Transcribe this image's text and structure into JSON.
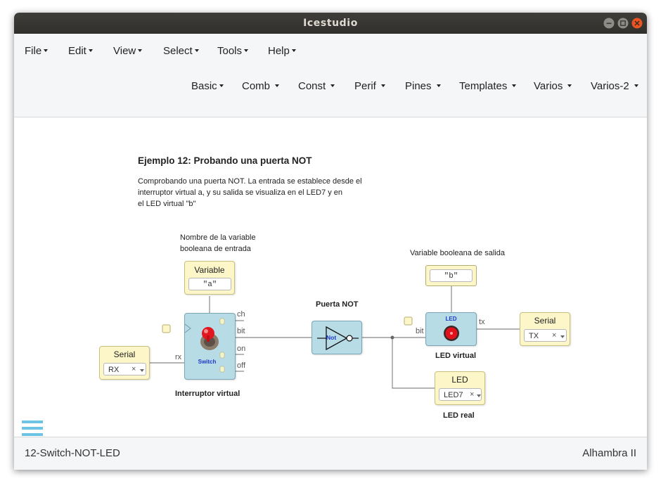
{
  "window": {
    "title": "Icestudio"
  },
  "menubar": {
    "main": [
      "File",
      "Edit",
      "View",
      "Select",
      "Tools",
      "Help"
    ],
    "collections": [
      "Basic",
      "Comb",
      "Const",
      "Perif",
      "Pines",
      "Templates",
      "Varios",
      "Varios-2"
    ]
  },
  "canvas": {
    "heading": "Ejemplo 12: Probando una puerta NOT",
    "description": [
      "Comprobando una puerta NOT. La entrada se establece desde el",
      "interruptor virtual a, y su salida se visualiza en el LED7 y en",
      "el LED virtual \"b\""
    ],
    "input_comment": [
      "Nombre de la variable",
      "booleana de entrada"
    ],
    "output_comment": "Variable booleana de salida",
    "variable_block": {
      "label": "Variable",
      "value": "\"a\""
    },
    "output_variable": {
      "value": "\"b\""
    },
    "switch_block": {
      "name": "Interruptor virtual",
      "text": "Switch",
      "ports": {
        "ch": "ch",
        "bit": "bit",
        "on": "on",
        "off": "off",
        "rx": "rx"
      }
    },
    "serial_in": {
      "label": "Serial",
      "value": "RX",
      "clear": "×"
    },
    "not_block": {
      "title": "Puerta NOT",
      "text": "Not"
    },
    "led_virtual": {
      "name": "LED virtual",
      "text": "LED",
      "ports": {
        "bit": "bit",
        "tx": "tx"
      }
    },
    "serial_out": {
      "label": "Serial",
      "value": "TX",
      "clear": "×"
    },
    "led_real": {
      "name": "LED real",
      "label": "LED",
      "value": "LED7",
      "clear": "×"
    }
  },
  "statusbar": {
    "project": "12-Switch-NOT-LED",
    "board": "Alhambra II"
  },
  "colors": {
    "block_fill": "#b8dce6",
    "io_fill": "#fdf6c8",
    "menu_icon": "#6cc4e4",
    "led_red": "#e0111b",
    "wire": "#777777"
  }
}
